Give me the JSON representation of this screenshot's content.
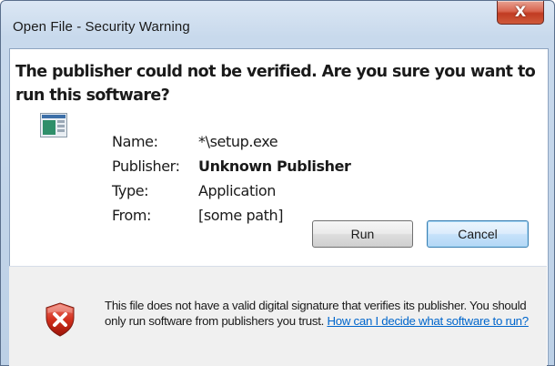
{
  "window": {
    "title": "Open File - Security Warning",
    "close_label": "X"
  },
  "headline": "The publisher could not be verified. Are you sure you want to run this software?",
  "details": {
    "name_label": "Name:",
    "name_value": "*\\setup.exe",
    "publisher_label": "Publisher:",
    "publisher_value": "Unknown Publisher",
    "type_label": "Type:",
    "type_value": "Application",
    "from_label": "From:",
    "from_value": "[some path]"
  },
  "buttons": {
    "run_label": "Run",
    "cancel_label": "Cancel"
  },
  "warning": {
    "text": "This file does not have a valid digital signature that verifies its publisher. You should only run software from publishers you trust.",
    "link_text": "How can I decide what software to run?"
  },
  "icons": {
    "app": "application-icon",
    "shield": "security-shield-error-icon"
  },
  "colors": {
    "link": "#0066cc",
    "close_button": "#c13b22",
    "title_gradient": "#c8d9ec"
  }
}
